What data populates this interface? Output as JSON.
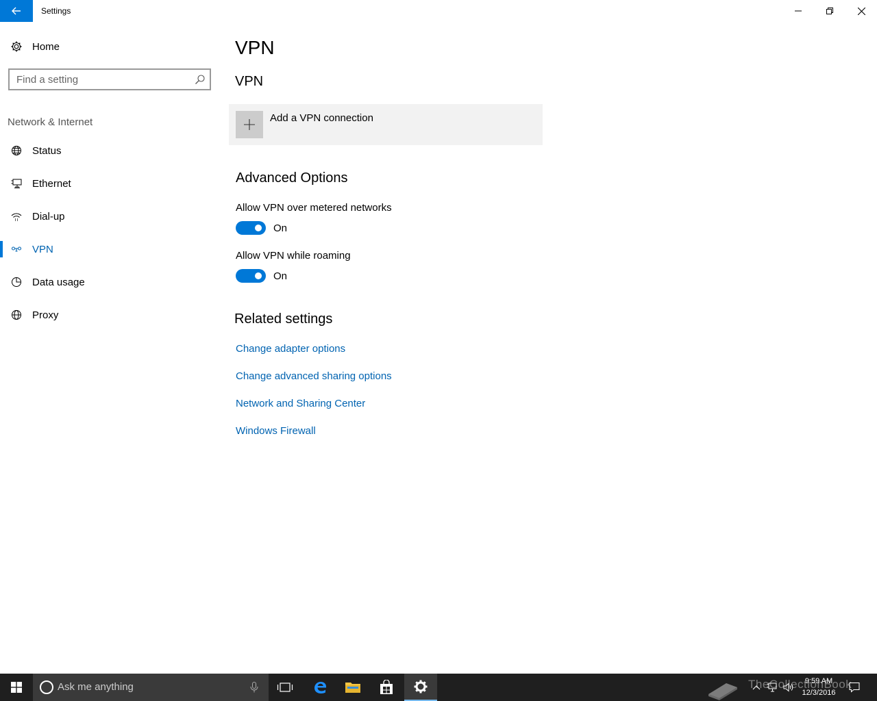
{
  "window": {
    "title": "Settings"
  },
  "sidebar": {
    "home_label": "Home",
    "search_placeholder": "Find a setting",
    "section_label": "Network & Internet",
    "items": [
      {
        "label": "Status",
        "icon": "globe-status-icon"
      },
      {
        "label": "Ethernet",
        "icon": "ethernet-icon"
      },
      {
        "label": "Dial-up",
        "icon": "dialup-icon"
      },
      {
        "label": "VPN",
        "icon": "vpn-icon",
        "active": true
      },
      {
        "label": "Data usage",
        "icon": "data-usage-icon"
      },
      {
        "label": "Proxy",
        "icon": "globe-icon"
      }
    ]
  },
  "main": {
    "page_title": "VPN",
    "vpn_heading": "VPN",
    "add_vpn_label": "Add a VPN connection",
    "advanced_heading": "Advanced Options",
    "options": [
      {
        "label": "Allow VPN over metered networks",
        "state": "On",
        "on": true
      },
      {
        "label": "Allow VPN while roaming",
        "state": "On",
        "on": true
      }
    ],
    "related_heading": "Related settings",
    "links": [
      "Change adapter options",
      "Change advanced sharing options",
      "Network and Sharing Center",
      "Windows Firewall"
    ]
  },
  "taskbar": {
    "search_placeholder": "Ask me anything",
    "time": "9:59 AM",
    "date": "12/3/2016",
    "watermark": "TheCollectionBook"
  },
  "colors": {
    "accent": "#0078d7",
    "link": "#0063b1",
    "taskbar": "#1f1f1f"
  }
}
